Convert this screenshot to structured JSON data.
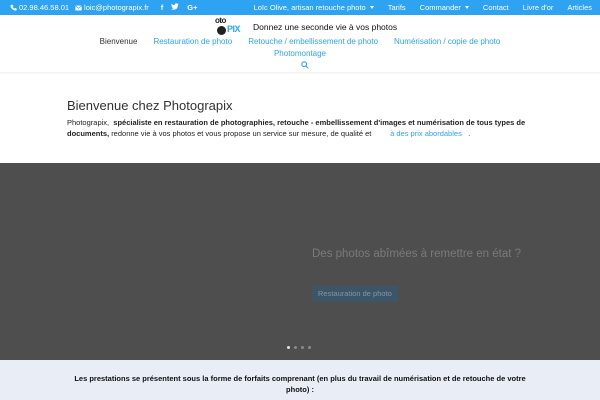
{
  "topbar": {
    "phone": "02.98.46.58.01",
    "email": "loic@photograpix.fr",
    "social": {
      "facebook": "f",
      "twitter": "twitter-bird",
      "googleplus": "G+"
    },
    "links": [
      {
        "label": "Loïc Olive, artisan retouche photo",
        "has_dropdown": true
      },
      {
        "label": "Tarifs",
        "has_dropdown": false
      },
      {
        "label": "Commander",
        "has_dropdown": true
      },
      {
        "label": "Contact",
        "has_dropdown": false
      },
      {
        "label": "Livre d'or",
        "has_dropdown": false
      },
      {
        "label": "Articles",
        "has_dropdown": false
      }
    ],
    "bg_color": "#2ea3f2"
  },
  "header": {
    "logo_line1": "oto",
    "logo_line2": "PIX",
    "tagline": "Donnez une seconde vie à vos photos"
  },
  "nav": {
    "items": [
      {
        "label": "Bienvenue",
        "active": true
      },
      {
        "label": "Restauration de photo",
        "active": false
      },
      {
        "label": "Retouche / embellissement de photo",
        "active": false
      },
      {
        "label": "Numérisation / copie de photo",
        "active": false
      }
    ],
    "second_row": {
      "label": "Photomontage",
      "active": false
    },
    "link_color": "#2ea3f2"
  },
  "welcome": {
    "title": "Bienvenue chez Photograpix",
    "intro_lead": "Photograpix,",
    "intro_bold": "spécialiste en restauration de photographies, retouche - embellissement d'images et numérisation de tous types de documents,",
    "intro_rest": "redonne vie à vos photos et vous propose un service sur mesure, de qualité et",
    "intro_link": "à des prix abordables",
    "intro_end": "."
  },
  "slider": {
    "title": "Des photos abîmées à remettre en état ?",
    "button_label": "Restauration de photo",
    "slide_count": 4,
    "active_index": 0
  },
  "bottom": {
    "text": "Les prestations se présentent sous la forme de forfaits comprenant (en plus du travail de numérisation et de retouche de votre photo) :"
  }
}
